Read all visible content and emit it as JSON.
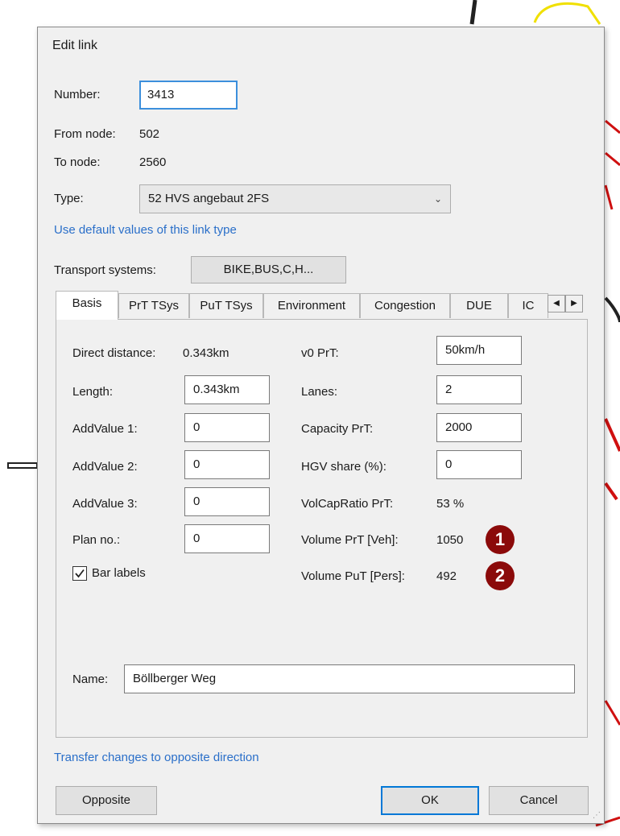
{
  "dialog": {
    "title": "Edit link",
    "number_label": "Number:",
    "number_value": "3413",
    "from_node_label": "From node:",
    "from_node_value": "502",
    "to_node_label": "To node:",
    "to_node_value": "2560",
    "type_label": "Type:",
    "type_value": "52 HVS angebaut 2FS",
    "default_values_link": "Use default values of this link type",
    "tsys_label": "Transport systems:",
    "tsys_button": "BIKE,BUS,C,H...",
    "transfer_link": "Transfer changes to opposite direction",
    "opposite_button": "Opposite",
    "ok_button": "OK",
    "cancel_button": "Cancel"
  },
  "tabs": [
    {
      "label": "Basis",
      "active": true
    },
    {
      "label": "PrT TSys"
    },
    {
      "label": "PuT TSys"
    },
    {
      "label": "Environment"
    },
    {
      "label": "Congestion"
    },
    {
      "label": "DUE"
    },
    {
      "label": "IC"
    }
  ],
  "basis": {
    "direct_distance_label": "Direct distance:",
    "direct_distance_value": "0.343km",
    "length_label": "Length:",
    "length_value": "0.343km",
    "addvalue1_label": "AddValue 1:",
    "addvalue1_value": "0",
    "addvalue2_label": "AddValue 2:",
    "addvalue2_value": "0",
    "addvalue3_label": "AddValue 3:",
    "addvalue3_value": "0",
    "planno_label": "Plan no.:",
    "planno_value": "0",
    "bar_labels_label": "Bar labels",
    "bar_labels_checked": true,
    "v0_label": "v0 PrT:",
    "v0_value": "50km/h",
    "lanes_label": "Lanes:",
    "lanes_value": "2",
    "capacity_label": "Capacity PrT:",
    "capacity_value": "2000",
    "hgv_label": "HGV share (%):",
    "hgv_value": "0",
    "volcap_label": "VolCapRatio PrT:",
    "volcap_value": "53 %",
    "volume_prt_label": "Volume PrT [Veh]:",
    "volume_prt_value": "1050",
    "volume_put_label": "Volume PuT [Pers]:",
    "volume_put_value": "492",
    "name_label": "Name:",
    "name_value": "Böllberger Weg"
  },
  "markers": [
    "1",
    "2"
  ],
  "colors": {
    "marker": "#8b0a0a",
    "link": "#2a6fc9",
    "focus": "#3c8fdc"
  }
}
